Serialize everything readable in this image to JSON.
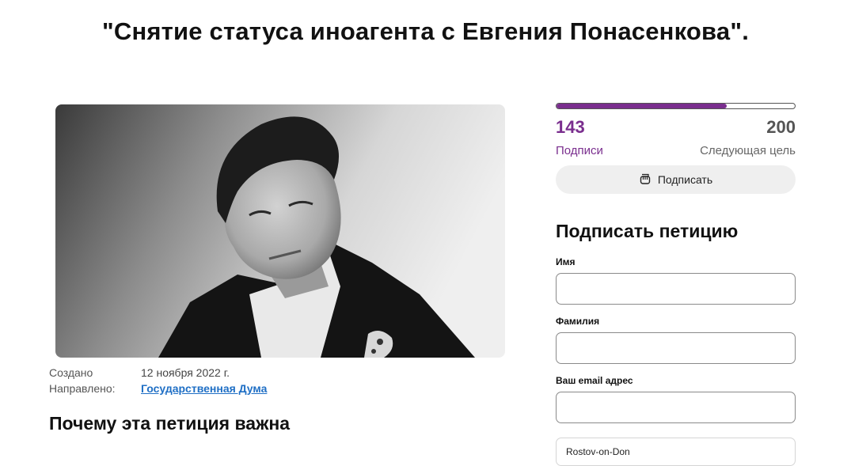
{
  "page": {
    "title": "\"Снятие статуса иноагента с Евгения Понасенкова\"."
  },
  "petition": {
    "image_alt": "Фото Евгения Понасенкова",
    "meta": {
      "created_label": "Создано",
      "created_value": "12 ноября 2022 г.",
      "directed_label": "Направлено:",
      "directed_value": "Государственная Дума"
    },
    "section_heading": "Почему эта петиция важна"
  },
  "progress": {
    "current": "143",
    "goal": "200",
    "fraction": 0.715,
    "current_label": "Подписи",
    "goal_label": "Следующая цель",
    "color": "#7a2e8e"
  },
  "sign_button": {
    "label": "Подписать",
    "icon": "fist-icon"
  },
  "form": {
    "title": "Подписать петицию",
    "first_name_label": "Имя",
    "first_name_value": "",
    "last_name_label": "Фамилия",
    "last_name_value": "",
    "email_label": "Ваш email адрес",
    "email_value": "",
    "city_value": "Rostov-on-Don"
  }
}
